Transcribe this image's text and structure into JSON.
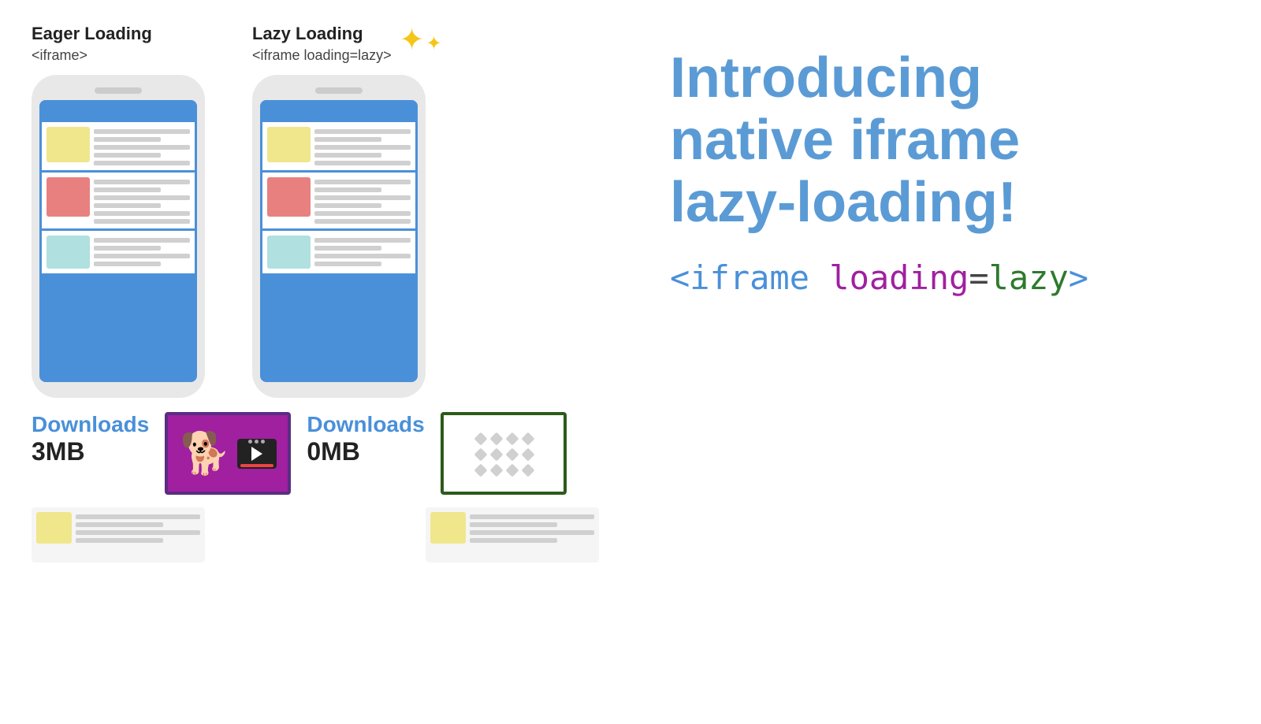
{
  "eager": {
    "title": "Eager Loading",
    "subtitle": "<iframe>",
    "downloads_label": "Downloads",
    "downloads_size": "3MB"
  },
  "lazy": {
    "title": "Lazy Loading",
    "subtitle": "<iframe loading=lazy>",
    "downloads_label": "Downloads",
    "downloads_size": "0MB"
  },
  "right": {
    "intro_line1": "Introducing",
    "intro_line2": "native iframe",
    "intro_line3": "lazy-loading!",
    "code_prefix": "<iframe ",
    "code_loading": "loading",
    "code_equals": "=",
    "code_lazy": "lazy",
    "code_suffix": ">"
  },
  "colors": {
    "blue": "#4a90d9",
    "purple": "#a020a0",
    "green": "#2d7a2d",
    "sparkle": "#f5c518"
  }
}
